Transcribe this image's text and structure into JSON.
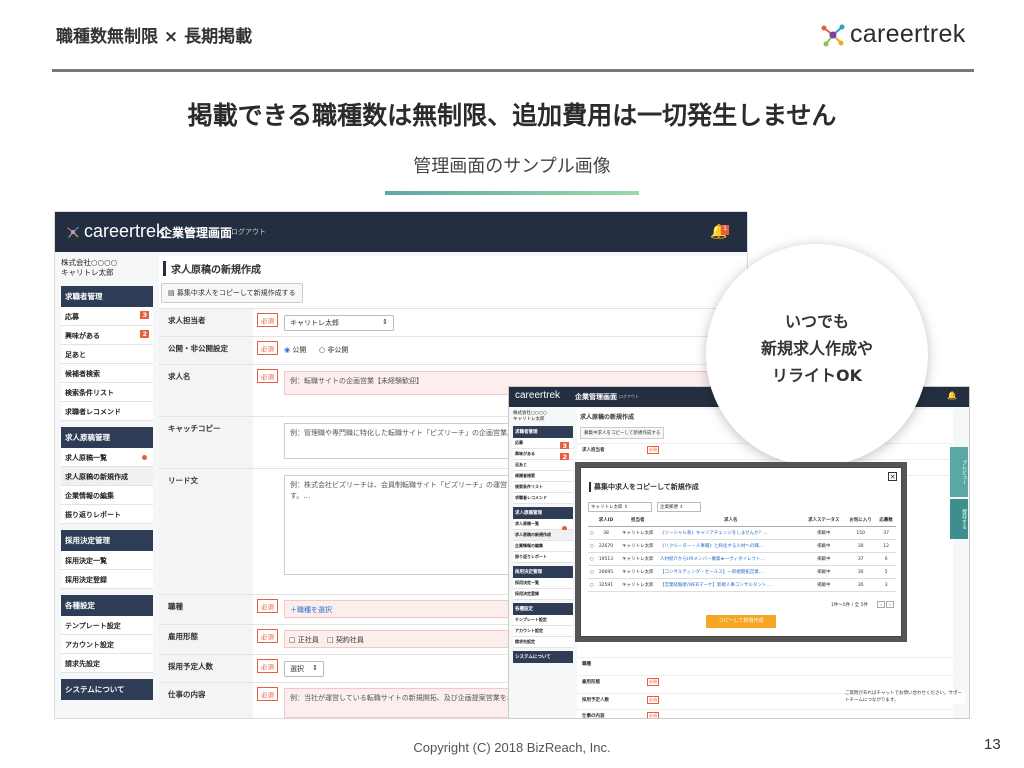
{
  "header": {
    "title": "職種数無制限 × 長期掲載",
    "logo_text": "careertrek"
  },
  "headline": "掲載できる職種数は無制限、追加費用は一切発生しません",
  "subhead": "管理画面のサンプル画像",
  "app": {
    "logo_text": "careertrek",
    "admin_label": "企業管理画面",
    "logout_label": "ログアウト",
    "bell_count": "1",
    "company_name": "株式会社○○○○",
    "user_name": "キャリトレ太郎"
  },
  "sidebar": {
    "sections": [
      {
        "title": "求職者管理",
        "items": [
          {
            "label": "応募",
            "badge": "3"
          },
          {
            "label": "興味がある",
            "badge": "2"
          },
          {
            "label": "足あと",
            "badge": ""
          },
          {
            "label": "候補者検索",
            "badge": ""
          },
          {
            "label": "検索条件リスト",
            "badge": ""
          },
          {
            "label": "求職者レコメンド",
            "badge": ""
          }
        ]
      },
      {
        "title": "求人原稿管理",
        "items": [
          {
            "label": "求人原稿一覧",
            "badge": ""
          },
          {
            "label": "求人原稿の新規作成",
            "badge": ""
          },
          {
            "label": "企業情報の編集",
            "badge": ""
          },
          {
            "label": "振り返りレポート",
            "badge": ""
          }
        ]
      },
      {
        "title": "採用決定管理",
        "items": [
          {
            "label": "採用決定一覧",
            "badge": ""
          },
          {
            "label": "採用決定登録",
            "badge": ""
          }
        ]
      },
      {
        "title": "各種設定",
        "items": [
          {
            "label": "テンプレート設定",
            "badge": ""
          },
          {
            "label": "アカウント設定",
            "badge": ""
          },
          {
            "label": "請求先設定",
            "badge": ""
          }
        ]
      },
      {
        "title": "システムについて",
        "items": []
      }
    ]
  },
  "form": {
    "page_title": "求人原稿の新規作成",
    "copy_button": "募集中求人をコピーして新規作成する",
    "required": "必須",
    "fields": {
      "owner_label": "求人担当者",
      "owner_value": "キャリトレ太郎",
      "public_label": "公開・非公開設定",
      "public_opt": "公開",
      "private_opt": "非公開",
      "name_label": "求人名",
      "name_ph": "例：転職サイトの企画営業【未経験歓迎】",
      "catch_label": "キャッチコピー",
      "catch_ph": "例：管理職や専門職に特化した転職サイト「ビズリーチ」の企画営業。新規事業の企画にも携わっていただくことが可能です！",
      "lead_label": "リード文",
      "lead_ph": "例：株式会社ビズリーチは、会員制転職サイト「ビズリーチ」の運営を行う会社です。求人情報や、非公開求人情報などに特化しております。…",
      "job_label": "職種",
      "job_link": "＋職種を選択",
      "emp_label": "雇用形態",
      "emp_opt1": "正社員",
      "emp_opt2": "契約社員",
      "count_label": "採用予定人数",
      "count_value": "選択",
      "work_label": "仕事の内容",
      "work_ph": "例：当社が運営している転職サイトの新規開拓、及び企画提案営業をお任せいたします"
    }
  },
  "callout": {
    "line1": "いつでも",
    "line2": "新規求人作成や",
    "line3": "リライトOK"
  },
  "second_shot": {
    "tab1": "プレビュー",
    "tab2": "保存する",
    "help": "ご質問があればチャットでお問い合わせください。サポートチームにつながります。"
  },
  "modal": {
    "title": "募集中求人をコピーして新規作成",
    "filter1": "キャリトレ太郎",
    "filter2": "企業郵便",
    "columns": [
      "求人ID",
      "担当者",
      "求人名",
      "求人ステータス",
      "お気に入り",
      "応募数"
    ],
    "rows": [
      {
        "id": "38",
        "owner": "キャリトレ太郎",
        "title": "《ソーシャル系》キャリアチェンジをしませんか？…",
        "status": "掲載中",
        "fav": "150",
        "apply": "37"
      },
      {
        "id": "22670",
        "owner": "キャリトレ太郎",
        "title": "《リクルーター・人事職》と純化する人材への職…",
        "status": "掲載中",
        "fav": "30",
        "apply": "12"
      },
      {
        "id": "19513",
        "owner": "キャリトレ太郎",
        "title": "人材紹介からHRメンバー募集★一ヴィダイレクト…",
        "status": "掲載中",
        "fav": "37",
        "apply": "6"
      },
      {
        "id": "20695",
        "owner": "キャリトレ太郎",
        "title": "【コンサルティング・セールス】ー新規開拓営業…",
        "status": "掲載中",
        "fav": "30",
        "apply": "5"
      },
      {
        "id": "32591",
        "owner": "キャリトレ太郎",
        "title": "【営業経験者/WEBマーケ】新規人事コンサルタント…",
        "status": "掲載中",
        "fav": "30",
        "apply": "3"
      }
    ],
    "pager": "1件～5件 / 全 5件",
    "submit": "コピーして新規作成"
  },
  "footer": {
    "copyright": "Copyright (C) 2018 BizReach, Inc.",
    "page": "13"
  }
}
